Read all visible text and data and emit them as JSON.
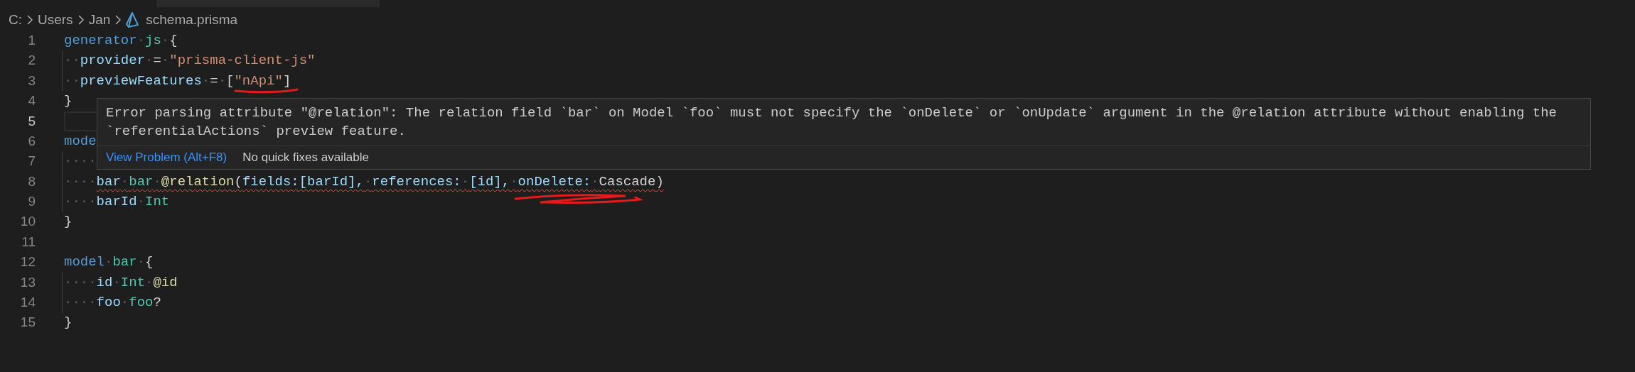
{
  "breadcrumb": [
    {
      "text": "C:",
      "kind": "folder"
    },
    {
      "text": "Users",
      "kind": "folder"
    },
    {
      "text": "Jan",
      "kind": "folder"
    },
    {
      "text": "schema.prisma",
      "kind": "file"
    }
  ],
  "lines": [
    {
      "number": "1",
      "current": false,
      "tokens": [
        {
          "text": "generator",
          "kind": "keyword"
        },
        {
          "text": "·",
          "kind": "space"
        },
        {
          "text": "js",
          "kind": "type"
        },
        {
          "text": "·",
          "kind": "space"
        },
        {
          "text": "{",
          "kind": "punct"
        }
      ]
    },
    {
      "number": "2",
      "current": false,
      "tokens": [
        {
          "text": "··",
          "kind": "indent"
        },
        {
          "text": "provider",
          "kind": "field"
        },
        {
          "text": "·",
          "kind": "space"
        },
        {
          "text": "=",
          "kind": "punct"
        },
        {
          "text": "·",
          "kind": "space"
        },
        {
          "text": "\"prisma-client-js\"",
          "kind": "string"
        }
      ]
    },
    {
      "number": "3",
      "current": false,
      "tokens": [
        {
          "text": "··",
          "kind": "indent"
        },
        {
          "text": "previewFeatures",
          "kind": "field"
        },
        {
          "text": "·",
          "kind": "space"
        },
        {
          "text": "=",
          "kind": "punct"
        },
        {
          "text": "·",
          "kind": "space"
        },
        {
          "text": "[",
          "kind": "punct"
        },
        {
          "text": "\"nApi\"",
          "kind": "string",
          "underlined": true
        },
        {
          "text": "]",
          "kind": "punct"
        }
      ]
    },
    {
      "number": "4",
      "current": false,
      "tokens": [
        {
          "text": "}",
          "kind": "punct"
        }
      ]
    },
    {
      "number": "5",
      "current": true
    },
    {
      "number": "6",
      "current": false,
      "tokens": [
        {
          "text": "mode",
          "kind": "keyword"
        }
      ]
    },
    {
      "number": "7",
      "current": false,
      "tokens": [
        {
          "text": "····",
          "kind": "indent"
        }
      ]
    },
    {
      "number": "8",
      "current": false,
      "tokens": [
        {
          "text": "····",
          "kind": "indent"
        },
        {
          "text": "bar",
          "kind": "field",
          "error": true
        },
        {
          "text": "·",
          "kind": "space",
          "error": true
        },
        {
          "text": "bar",
          "kind": "type",
          "error": true
        },
        {
          "text": "·",
          "kind": "space",
          "error": true
        },
        {
          "text": "@relation",
          "kind": "attribute",
          "error": true
        },
        {
          "text": "(",
          "kind": "punct",
          "error": true
        },
        {
          "text": "fields:[barId],",
          "kind": "field",
          "error": true
        },
        {
          "text": "·",
          "kind": "space",
          "error": true
        },
        {
          "text": "references:",
          "kind": "field",
          "error": true
        },
        {
          "text": "·",
          "kind": "space",
          "error": true
        },
        {
          "text": "[id],",
          "kind": "field",
          "error": true
        },
        {
          "text": "·",
          "kind": "space",
          "error": true
        },
        {
          "text": "onDelete:",
          "kind": "field",
          "error": true,
          "scribbled": true
        },
        {
          "text": "·",
          "kind": "space",
          "error": true
        },
        {
          "text": "Cascade",
          "kind": "plain",
          "error": true
        },
        {
          "text": ")",
          "kind": "punct",
          "error": true
        }
      ]
    },
    {
      "number": "9",
      "current": false,
      "tokens": [
        {
          "text": "····",
          "kind": "indent"
        },
        {
          "text": "barId",
          "kind": "field"
        },
        {
          "text": "·",
          "kind": "space"
        },
        {
          "text": "Int",
          "kind": "type"
        }
      ]
    },
    {
      "number": "10",
      "current": false,
      "tokens": [
        {
          "text": "}",
          "kind": "punct"
        }
      ]
    },
    {
      "number": "11",
      "current": false
    },
    {
      "number": "12",
      "current": false,
      "tokens": [
        {
          "text": "model",
          "kind": "keyword"
        },
        {
          "text": "·",
          "kind": "space"
        },
        {
          "text": "bar",
          "kind": "type"
        },
        {
          "text": "·",
          "kind": "space"
        },
        {
          "text": "{",
          "kind": "punct"
        }
      ]
    },
    {
      "number": "13",
      "current": false,
      "tokens": [
        {
          "text": "····",
          "kind": "indent"
        },
        {
          "text": "id",
          "kind": "field"
        },
        {
          "text": "·",
          "kind": "space"
        },
        {
          "text": "Int",
          "kind": "type"
        },
        {
          "text": "·",
          "kind": "space"
        },
        {
          "text": "@id",
          "kind": "attribute"
        }
      ]
    },
    {
      "number": "14",
      "current": false,
      "tokens": [
        {
          "text": "····",
          "kind": "indent"
        },
        {
          "text": "foo",
          "kind": "field"
        },
        {
          "text": "·",
          "kind": "space"
        },
        {
          "text": "foo",
          "kind": "type"
        },
        {
          "text": "?",
          "kind": "plain"
        }
      ]
    },
    {
      "number": "15",
      "current": false,
      "tokens": [
        {
          "text": "}",
          "kind": "punct"
        }
      ]
    }
  ],
  "hover": {
    "message": "Error parsing attribute \"@relation\": The relation field `bar` on Model `foo` must not specify the `onDelete` or `onUpdate` argument in the @relation attribute without enabling the `referentialActions` preview feature.",
    "action": "View Problem (Alt+F8)",
    "note": "No quick fixes available"
  }
}
